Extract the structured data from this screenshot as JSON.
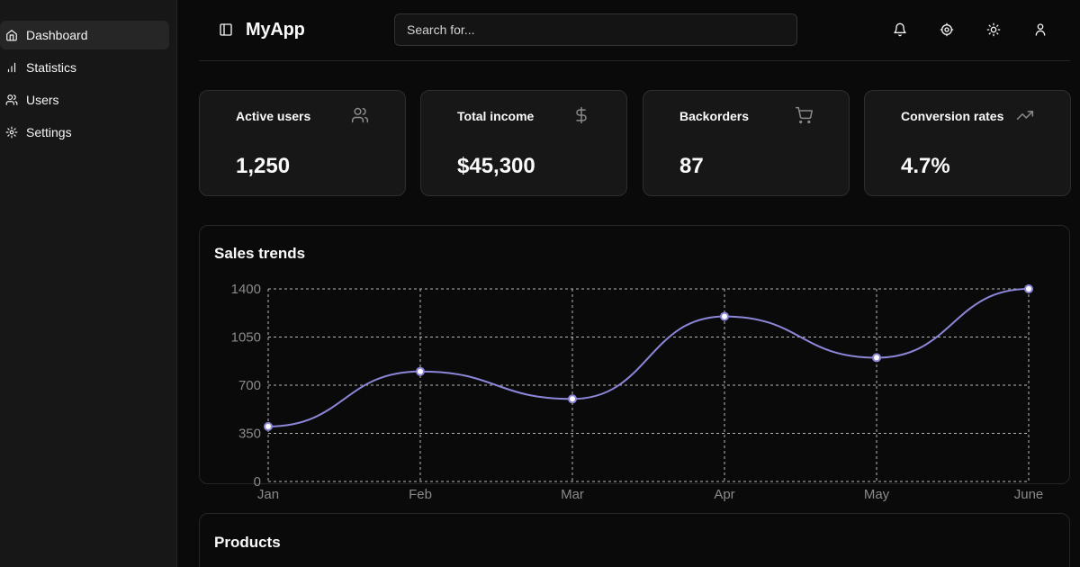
{
  "sidebar": {
    "items": [
      {
        "label": "Dashboard",
        "icon": "home-icon",
        "active": true
      },
      {
        "label": "Statistics",
        "icon": "bar-chart-icon",
        "active": false
      },
      {
        "label": "Users",
        "icon": "users-icon",
        "active": false
      },
      {
        "label": "Settings",
        "icon": "gear-icon",
        "active": false
      }
    ]
  },
  "header": {
    "title": "MyApp",
    "search_placeholder": "Search for...",
    "icons": [
      "bell-icon",
      "gear-icon",
      "sun-icon",
      "user-icon"
    ]
  },
  "stats": [
    {
      "title": "Active users",
      "value": "1,250",
      "icon": "users-icon"
    },
    {
      "title": "Total income",
      "value": "$45,300",
      "icon": "dollar-icon"
    },
    {
      "title": "Backorders",
      "value": "87",
      "icon": "cart-icon"
    },
    {
      "title": "Conversion rates",
      "value": "4.7%",
      "icon": "trending-up-icon"
    }
  ],
  "sales_panel": {
    "title": "Sales trends"
  },
  "products_panel": {
    "title": "Products"
  },
  "colors": {
    "accent": "#8b86d8",
    "background": "#0a0a0a",
    "card": "#171717"
  },
  "chart_data": {
    "type": "line",
    "categories": [
      "Jan",
      "Feb",
      "Mar",
      "Apr",
      "May",
      "June"
    ],
    "series": [
      {
        "values": [
          400,
          800,
          600,
          1200,
          900,
          1400
        ]
      }
    ],
    "yticks": [
      0,
      350,
      700,
      1050,
      1400
    ],
    "ylim": [
      0,
      1400
    ],
    "grid": true,
    "smooth": true
  }
}
